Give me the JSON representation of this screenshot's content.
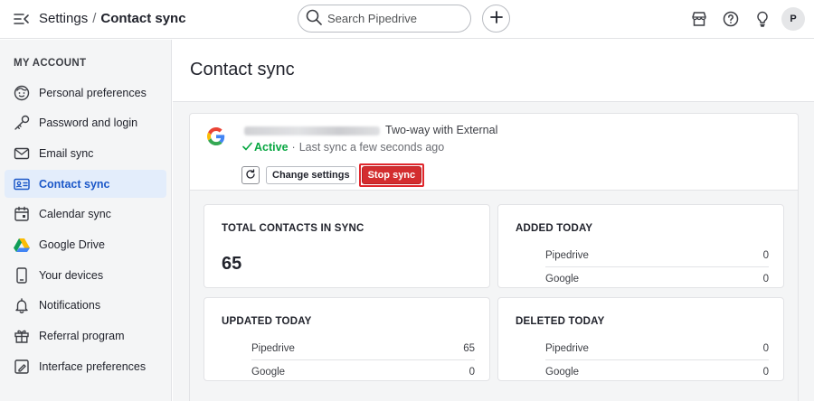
{
  "header": {
    "breadcrumb_parent": "Settings",
    "breadcrumb_separator": "/",
    "breadcrumb_current": "Contact sync",
    "search_placeholder": "Search Pipedrive",
    "avatar_initial": "P"
  },
  "sidebar": {
    "heading": "MY ACCOUNT",
    "items": [
      {
        "label": "Personal preferences",
        "icon": "face-icon"
      },
      {
        "label": "Password and login",
        "icon": "key-icon"
      },
      {
        "label": "Email sync",
        "icon": "mail-icon"
      },
      {
        "label": "Contact sync",
        "icon": "contact-card-icon",
        "active": true
      },
      {
        "label": "Calendar sync",
        "icon": "calendar-icon"
      },
      {
        "label": "Google Drive",
        "icon": "google-drive-icon"
      },
      {
        "label": "Your devices",
        "icon": "phone-icon"
      },
      {
        "label": "Notifications",
        "icon": "bell-icon"
      },
      {
        "label": "Referral program",
        "icon": "gift-icon"
      },
      {
        "label": "Interface preferences",
        "icon": "interface-icon"
      }
    ]
  },
  "main": {
    "title": "Contact sync",
    "account": {
      "sync_type": "Two-way with External",
      "status": "Active",
      "status_separator": "·",
      "last_sync": "Last sync a few seconds ago",
      "change_settings_label": "Change settings",
      "stop_sync_label": "Stop sync"
    },
    "stats": {
      "total": {
        "title": "TOTAL CONTACTS IN SYNC",
        "value": "65"
      },
      "added": {
        "title": "ADDED TODAY",
        "rows": [
          {
            "label": "Pipedrive",
            "value": "0"
          },
          {
            "label": "Google",
            "value": "0"
          }
        ]
      },
      "updated": {
        "title": "UPDATED TODAY",
        "rows": [
          {
            "label": "Pipedrive",
            "value": "65"
          },
          {
            "label": "Google",
            "value": "0"
          }
        ]
      },
      "deleted": {
        "title": "DELETED TODAY",
        "rows": [
          {
            "label": "Pipedrive",
            "value": "0"
          },
          {
            "label": "Google",
            "value": "0"
          }
        ]
      }
    }
  },
  "colors": {
    "accent": "#1c58c8",
    "active_status": "#08a742",
    "danger": "#d32d2f"
  }
}
